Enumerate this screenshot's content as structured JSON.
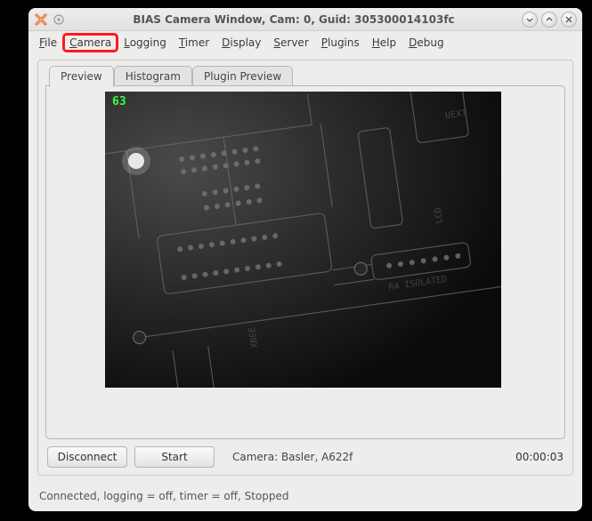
{
  "window": {
    "title": "BIAS Camera Window, Cam: 0, Guid: 305300014103fc"
  },
  "menu": {
    "file": {
      "label": "File",
      "ul": "F"
    },
    "camera": {
      "label": "Camera",
      "ul": "C"
    },
    "logging": {
      "label": "Logging",
      "ul": "L"
    },
    "timer": {
      "label": "Timer",
      "ul": "T"
    },
    "display": {
      "label": "Display",
      "ul": "D"
    },
    "server": {
      "label": "Server",
      "ul": "S"
    },
    "plugins": {
      "label": "Plugins",
      "ul": "P"
    },
    "help": {
      "label": "Help",
      "ul": "H"
    },
    "debug": {
      "label": "Debug",
      "ul": "D"
    }
  },
  "tabs": {
    "preview": "Preview",
    "histogram": "Histogram",
    "plugin_preview": "Plugin Preview"
  },
  "preview": {
    "fps": "63"
  },
  "controls": {
    "disconnect": "Disconnect",
    "start": "Start",
    "camera_label": "Camera:  Basler,  A622f",
    "clock": "00:00:03"
  },
  "status": "Connected, logging = off, timer = off, Stopped"
}
